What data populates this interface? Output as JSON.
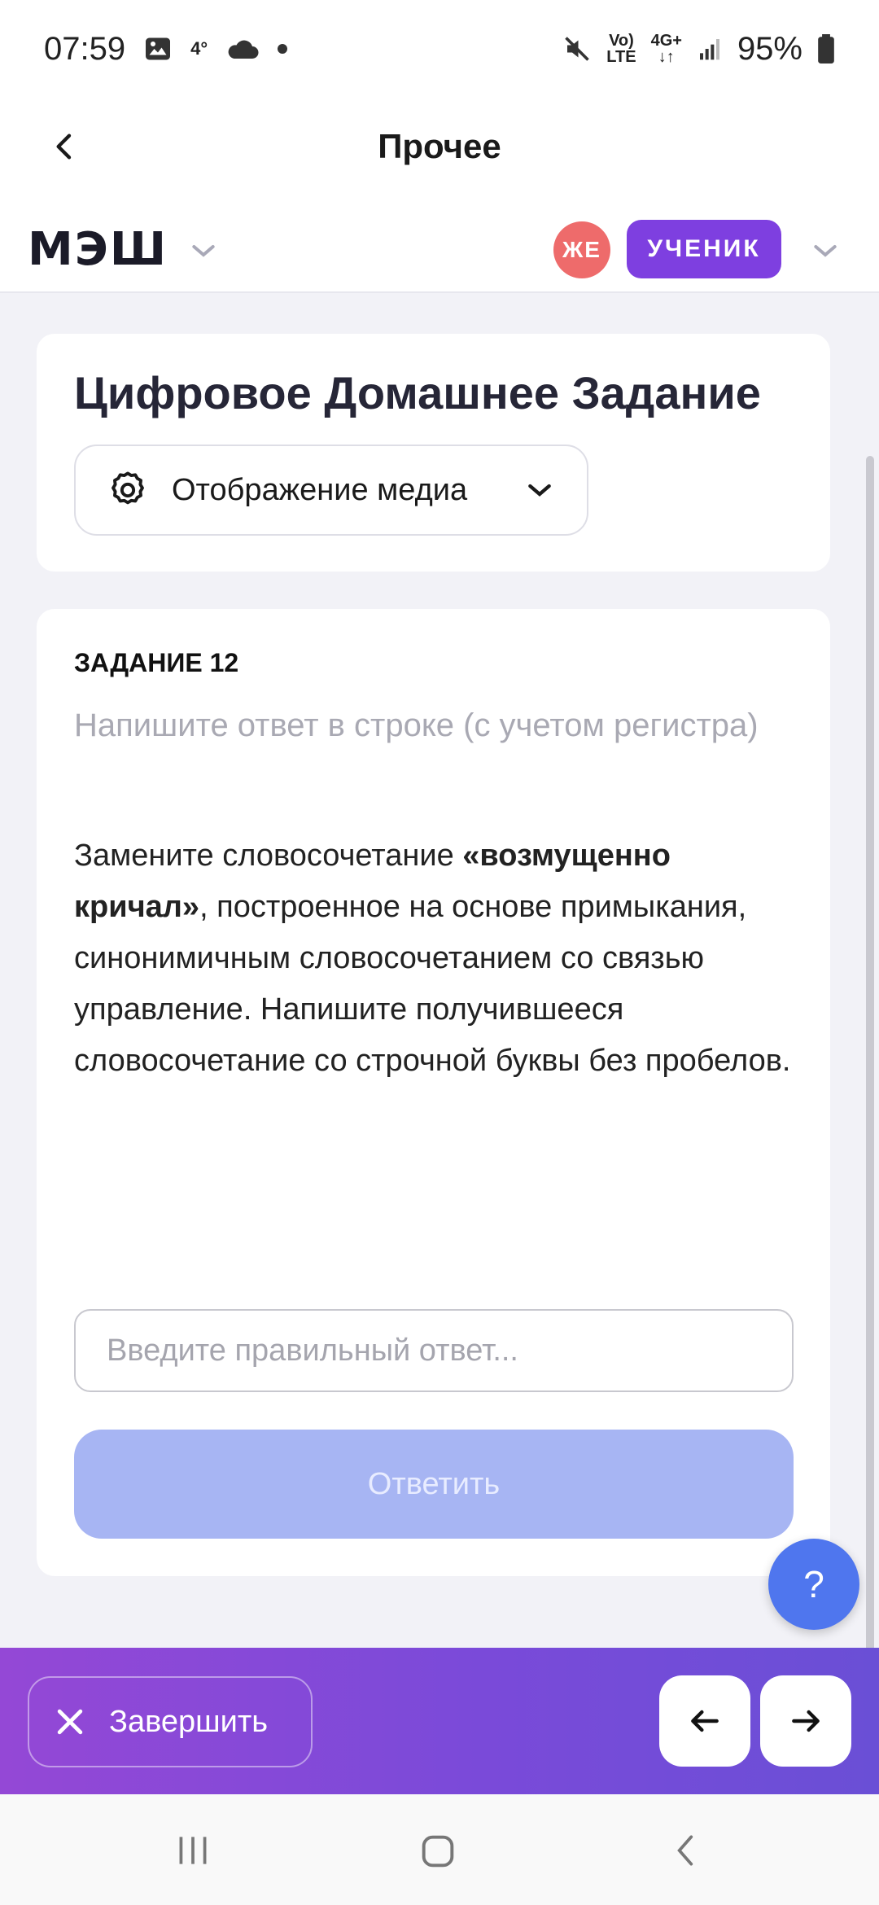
{
  "status_bar": {
    "time": "07:59",
    "temperature": "4°",
    "network_top": "Vo)",
    "network_bottom": "LTE",
    "mobile_top": "4G+",
    "battery": "95%"
  },
  "top_bar": {
    "title": "Прочее"
  },
  "app_bar": {
    "logo": "МЭШ",
    "avatar_initials": "ЖЕ",
    "role": "УЧЕНИК"
  },
  "header_card": {
    "title": "Цифровое Домашнее Задание",
    "media_button_label": "Отображение медиа"
  },
  "task": {
    "number_label": "ЗАДАНИЕ 12",
    "hint": "Напишите ответ в строке (с учетом регистра)",
    "text_before": "Замените словосочетание ",
    "text_bold": "«возмущенно кричал»",
    "text_after": ", построенное на основе примыкания, синонимичным словосочетанием со связью управление. Напишите получившееся словосочетание со строчной буквы без пробелов.",
    "answer_placeholder": "Введите правильный ответ...",
    "answer_value": "",
    "submit_label": "Ответить"
  },
  "help": {
    "label": "?"
  },
  "bottom_bar": {
    "finish_label": "Завершить"
  },
  "colors": {
    "accent_purple": "#7e3fe0",
    "avatar_red": "#ee6b6b",
    "submit_disabled": "#a7b5f3",
    "help_blue": "#4f76ee"
  }
}
